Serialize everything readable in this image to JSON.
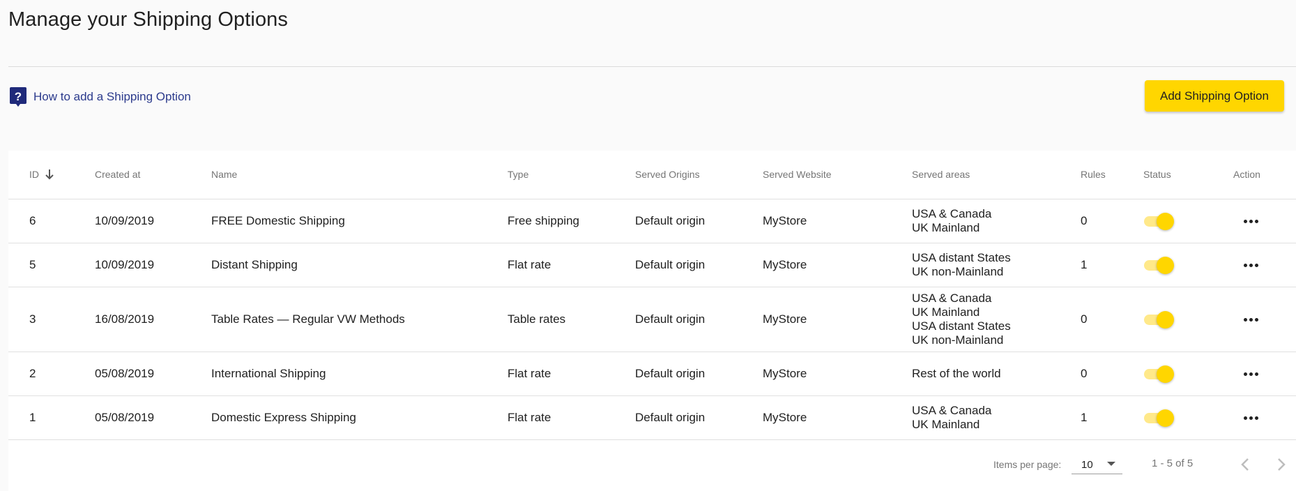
{
  "page": {
    "title": "Manage your Shipping Options"
  },
  "help": {
    "icon": "help-chat-icon",
    "label": "How to add a Shipping Option"
  },
  "actions": {
    "add_label": "Add Shipping Option"
  },
  "colors": {
    "accent": "#ffd600",
    "link": "#2b3a8c"
  },
  "table": {
    "columns": [
      {
        "key": "id",
        "label": "ID",
        "sorted": "desc"
      },
      {
        "key": "created_at",
        "label": "Created at"
      },
      {
        "key": "name",
        "label": "Name"
      },
      {
        "key": "type",
        "label": "Type"
      },
      {
        "key": "origins",
        "label": "Served Origins"
      },
      {
        "key": "website",
        "label": "Served Website"
      },
      {
        "key": "areas",
        "label": "Served areas"
      },
      {
        "key": "rules",
        "label": "Rules"
      },
      {
        "key": "status",
        "label": "Status"
      },
      {
        "key": "action",
        "label": "Action"
      }
    ],
    "rows": [
      {
        "id": "6",
        "created_at": "10/09/2019",
        "name": "FREE Domestic Shipping",
        "type": "Free shipping",
        "origins": "Default origin",
        "website": "MyStore",
        "areas": [
          "USA & Canada",
          "UK Mainland"
        ],
        "rules": "0",
        "status_on": true
      },
      {
        "id": "5",
        "created_at": "10/09/2019",
        "name": "Distant Shipping",
        "type": "Flat rate",
        "origins": "Default origin",
        "website": "MyStore",
        "areas": [
          "USA distant States",
          "UK non-Mainland"
        ],
        "rules": "1",
        "status_on": true
      },
      {
        "id": "3",
        "created_at": "16/08/2019",
        "name": "Table Rates — Regular VW Methods",
        "type": "Table rates",
        "origins": "Default origin",
        "website": "MyStore",
        "areas": [
          "USA & Canada",
          "UK Mainland",
          "USA distant States",
          "UK non-Mainland"
        ],
        "rules": "0",
        "status_on": true
      },
      {
        "id": "2",
        "created_at": "05/08/2019",
        "name": "International Shipping",
        "type": "Flat rate",
        "origins": "Default origin",
        "website": "MyStore",
        "areas": [
          "Rest of the world"
        ],
        "rules": "0",
        "status_on": true
      },
      {
        "id": "1",
        "created_at": "05/08/2019",
        "name": "Domestic Express Shipping",
        "type": "Flat rate",
        "origins": "Default origin",
        "website": "MyStore",
        "areas": [
          "USA & Canada",
          "UK Mainland"
        ],
        "rules": "1",
        "status_on": true
      }
    ]
  },
  "paginator": {
    "items_per_page_label": "Items per page:",
    "page_size": "10",
    "range": "1 - 5 of 5",
    "prev_icon": "chevron-left-icon",
    "next_icon": "chevron-right-icon"
  }
}
